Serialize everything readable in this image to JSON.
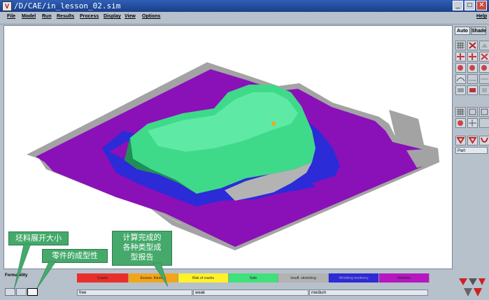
{
  "window": {
    "title": "/D/CAE/in_lesson_02.sim",
    "minimize": "_",
    "maximize": "□",
    "close": "✕"
  },
  "menu": {
    "items": [
      "File",
      "Model",
      "Run",
      "Results",
      "Process",
      "Display",
      "View",
      "Options"
    ],
    "help": "Help"
  },
  "panel": {
    "tabs": [
      {
        "label": "Auto",
        "active": true
      },
      {
        "label": "Shade",
        "active": false
      }
    ],
    "part_label": "Part"
  },
  "bottom": {
    "form_label": "Formability",
    "legend": [
      {
        "label": "Cracks",
        "color": "#e8302a"
      },
      {
        "label": "Excess. thinning",
        "color": "#f2a51b"
      },
      {
        "label": "Risk of cracks",
        "color": "#fff22b"
      },
      {
        "label": "Safe",
        "color": "#40e07a"
      },
      {
        "label": "Insuff. stretching",
        "color": "#b3b3b3"
      },
      {
        "label": "Wrinkling tendency",
        "color": "#2d2ad6"
      },
      {
        "label": "Wrinkles",
        "color": "#b518c0"
      }
    ],
    "status": [
      "free",
      "weak",
      "medium"
    ]
  },
  "callouts": {
    "blank_size": "坯料展开大小",
    "formability": "零件的成型性",
    "reports": "计算完成的\n各种类型成\n型报告"
  },
  "colors": {
    "blank_gray": "#a3a3a3",
    "wrinkles_purple": "#8a10b8",
    "wrinkling_blue": "#2b2bd8",
    "part_green": "#3fd98a",
    "callout_green": "#44a96b"
  }
}
